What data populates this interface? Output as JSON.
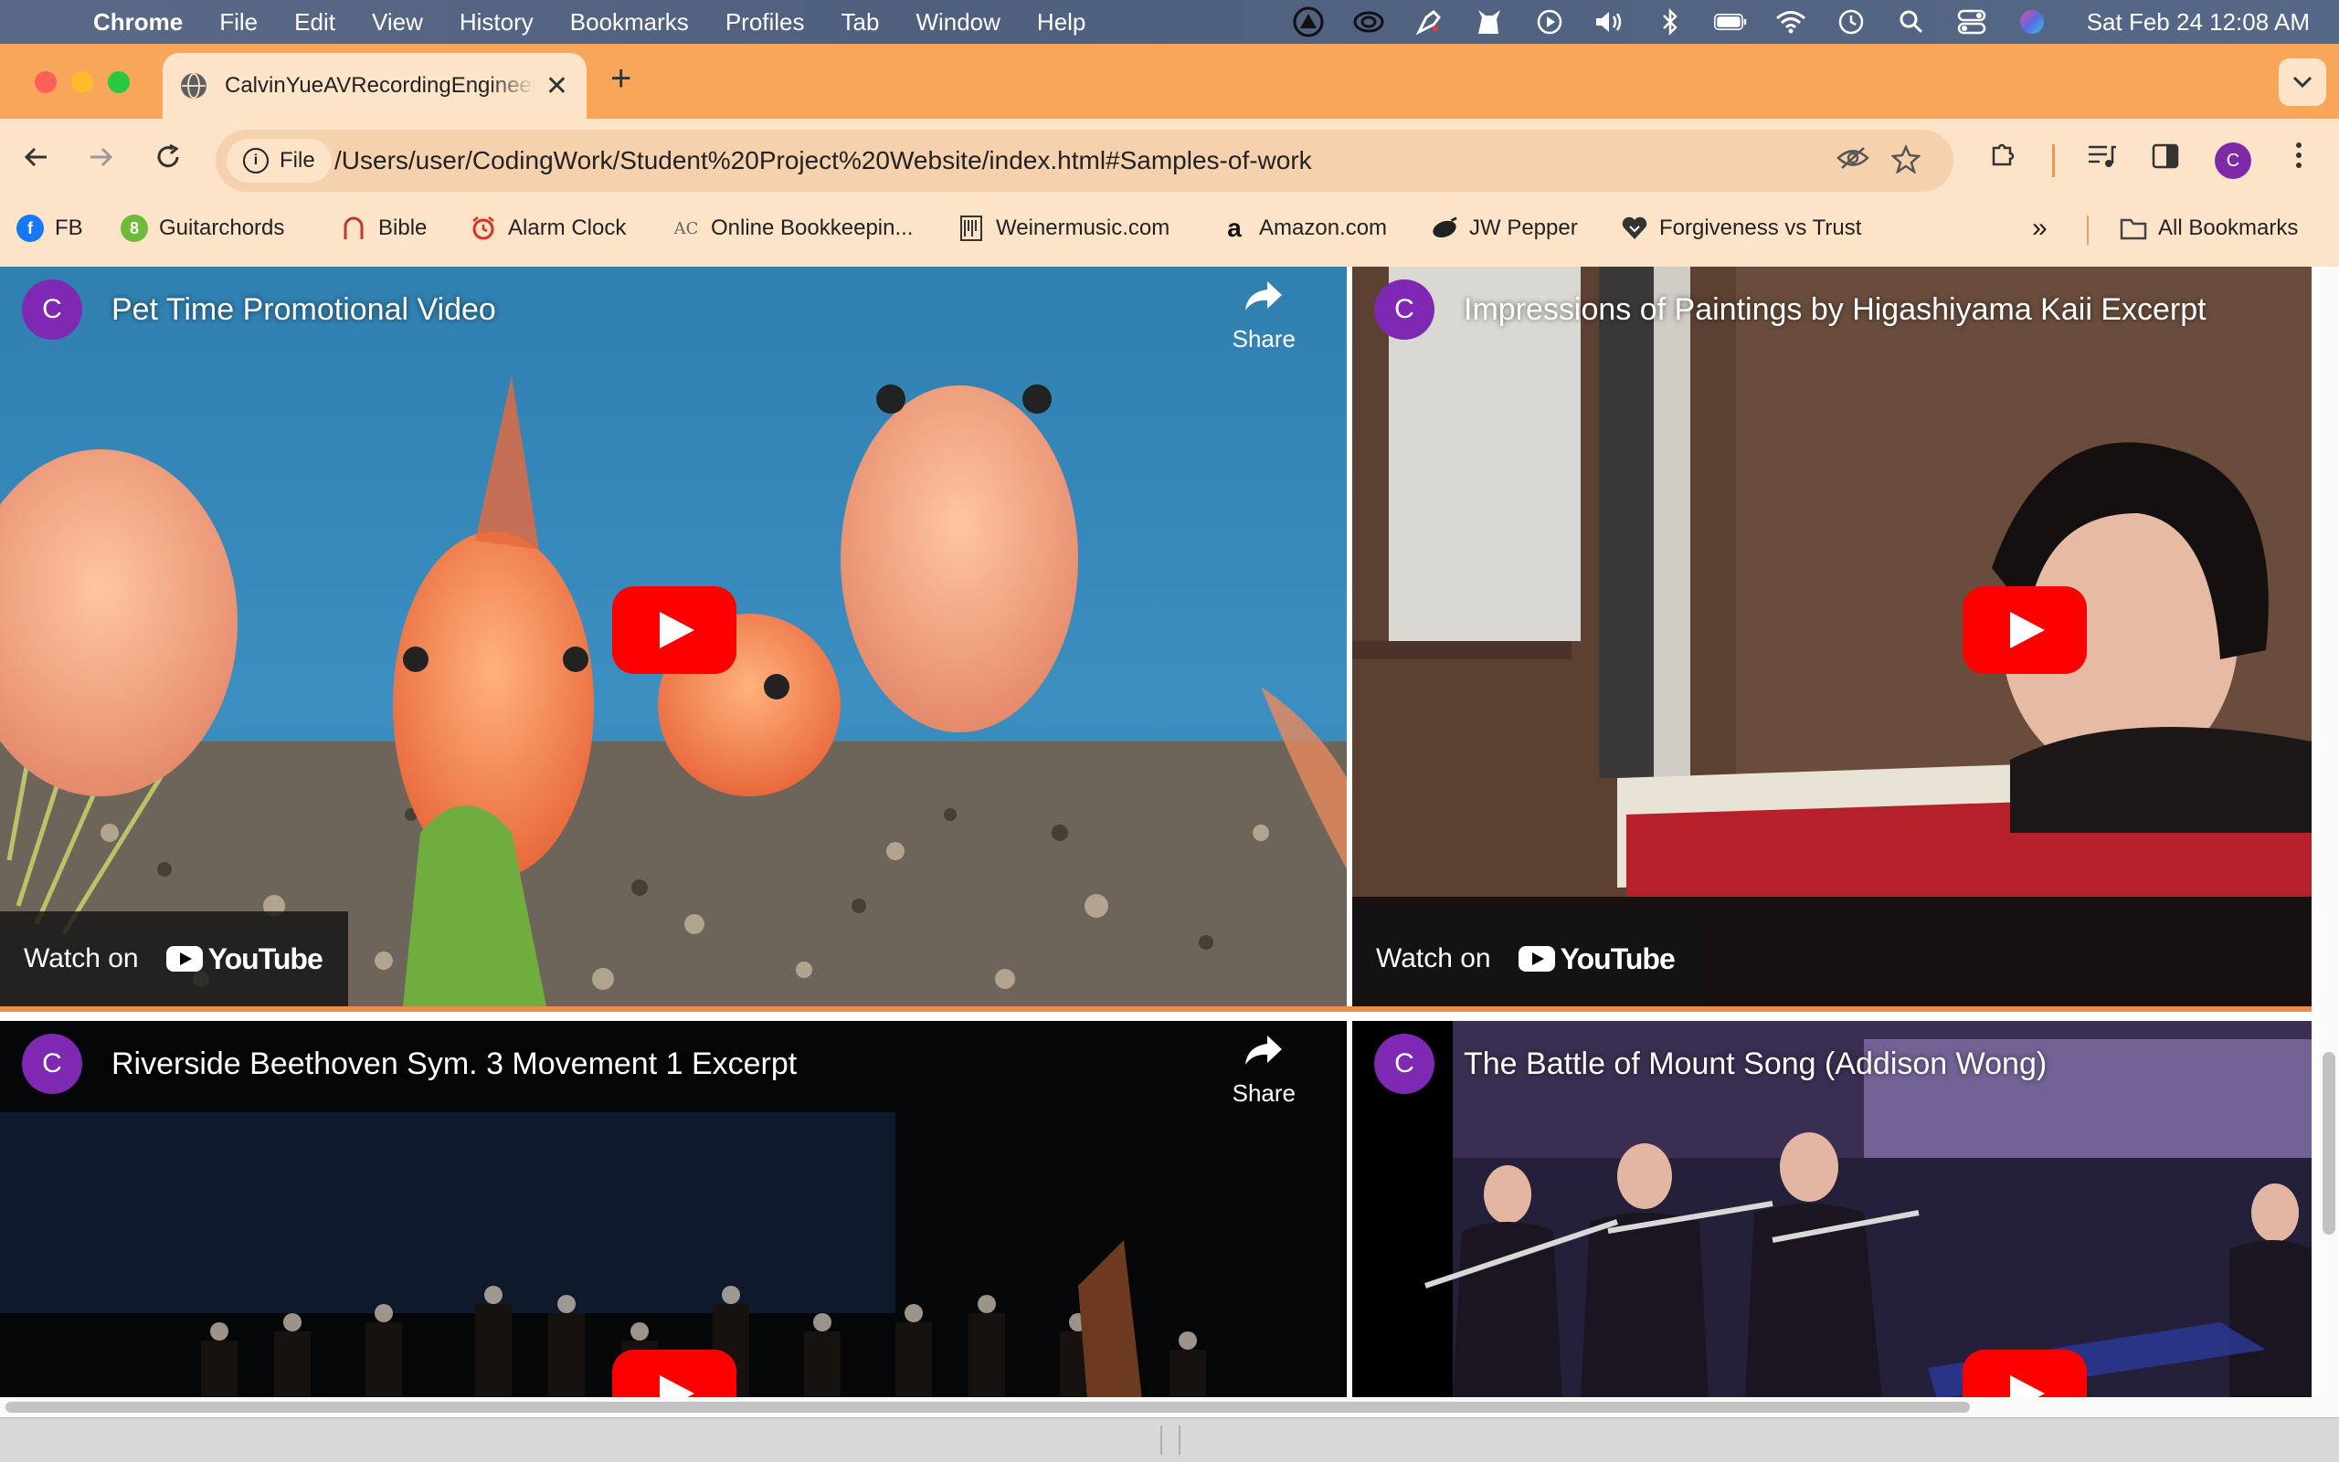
{
  "menubar": {
    "app": "Chrome",
    "items": [
      "File",
      "Edit",
      "View",
      "History",
      "Bookmarks",
      "Profiles",
      "Tab",
      "Window",
      "Help"
    ],
    "clock": "Sat Feb 24  12:08 AM"
  },
  "tab": {
    "title": "CalvinYueAVRecordingEngineer",
    "close": "✕"
  },
  "toolbar": {
    "chip_label": "File",
    "url": "/Users/user/CodingWork/Student%20Project%20Website/index.html#Samples-of-work",
    "profile_initial": "C"
  },
  "bookmarks": {
    "items": [
      {
        "label": "FB",
        "icon": "facebook-icon",
        "color": "#1877f2"
      },
      {
        "label": "Guitarchords",
        "icon": "guitarchords-icon",
        "color": "#6dbb3a"
      },
      {
        "label": "Bible",
        "icon": "bible-icon",
        "color": "#c0392b"
      },
      {
        "label": "Alarm Clock",
        "icon": "alarm-clock-icon",
        "color": "#d93025"
      },
      {
        "label": "Online Bookkeepin...",
        "icon": "ac-icon",
        "color": "#555555"
      },
      {
        "label": "Weinermusic.com",
        "icon": "weinermusic-icon",
        "color": "#333333"
      },
      {
        "label": "Amazon.com",
        "icon": "amazon-icon",
        "color": "#111111"
      },
      {
        "label": "JW Pepper",
        "icon": "jw-pepper-icon",
        "color": "#222222"
      },
      {
        "label": "Forgiveness vs Trust",
        "icon": "heart-icon",
        "color": "#333333"
      }
    ],
    "all_bookmarks": "All Bookmarks"
  },
  "videos": [
    {
      "title": "Pet Time Promotional Video",
      "channel": "C",
      "share": "Share",
      "watch": "Watch on",
      "brand": "YouTube"
    },
    {
      "title": "Impressions of Paintings by Higashiyama Kaii Excerpt",
      "channel": "C",
      "watch": "Watch on",
      "brand": "YouTube"
    },
    {
      "title": "Riverside Beethoven Sym. 3 Movement 1 Excerpt",
      "channel": "C",
      "share": "Share"
    },
    {
      "title": "The Battle of Mount Song (Addison Wong)",
      "channel": "C"
    }
  ]
}
